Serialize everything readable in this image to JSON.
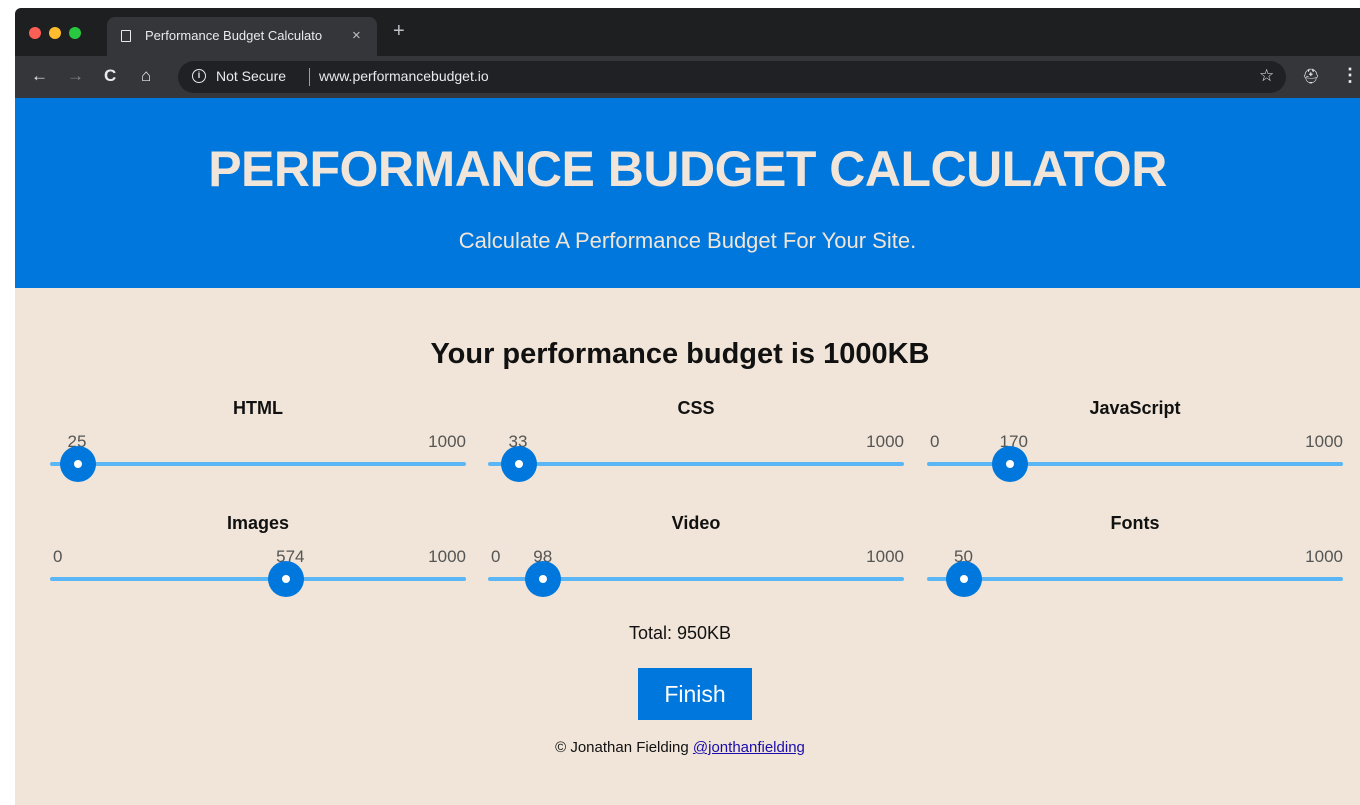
{
  "browser": {
    "tab_title": "Performance Budget Calculato",
    "tab_close": "×",
    "new_tab": "+",
    "security_label": "Not Secure",
    "url": "www.performancebudget.io",
    "icons": {
      "back": "arrow-left-icon",
      "forward": "arrow-right-icon",
      "reload": "reload-icon",
      "home": "home-icon",
      "info": "info-icon",
      "bookmark": "star-icon",
      "incognito": "incognito-icon",
      "menu": "kebab-menu-icon"
    }
  },
  "hero": {
    "title": "PERFORMANCE BUDGET CALCULATOR",
    "subtitle": "Calculate A Performance Budget For Your Site."
  },
  "budget": {
    "title": "Your performance budget is 1000KB"
  },
  "sliders": [
    {
      "label": "HTML",
      "min_label": "",
      "value": 25,
      "max_label": "1000",
      "min": 0,
      "max": 1000
    },
    {
      "label": "CSS",
      "min_label": "",
      "value": 33,
      "max_label": "1000",
      "min": 0,
      "max": 1000
    },
    {
      "label": "JavaScript",
      "min_label": "0",
      "value": 170,
      "max_label": "1000",
      "min": 0,
      "max": 1000
    },
    {
      "label": "Images",
      "min_label": "0",
      "value": 574,
      "max_label": "1000",
      "min": 0,
      "max": 1000
    },
    {
      "label": "Video",
      "min_label": "0",
      "value": 98,
      "max_label": "1000",
      "min": 0,
      "max": 1000
    },
    {
      "label": "Fonts",
      "min_label": "",
      "value": 50,
      "max_label": "1000",
      "min": 0,
      "max": 1000
    }
  ],
  "total": "Total: 950KB",
  "finish_label": "Finish",
  "footer": {
    "text": "© Jonathan Fielding",
    "link": "@jonthanfielding"
  },
  "colors": {
    "primary": "#0077dd",
    "track": "#5ab6f5",
    "background": "#f0e5d8"
  }
}
